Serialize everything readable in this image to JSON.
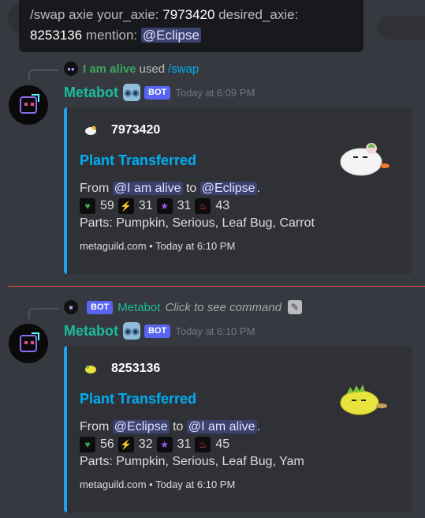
{
  "tooltip": {
    "cmd": "/swap",
    "label_axie": "axie",
    "label_your": "your_axie:",
    "your_val": "7973420",
    "label_desired": "desired_axie:",
    "desired_val": "8253136",
    "label_mention": "mention:",
    "mention_val": "@Eclipse"
  },
  "messages": [
    {
      "reply": {
        "user": "I am alive",
        "used": "used",
        "command": "/swap"
      },
      "author": "Metabot",
      "bot_tag": "BOT",
      "timestamp": "Today at 6:09 PM",
      "embed": {
        "author": "7973420",
        "title": "Plant Transferred",
        "from_label": "From",
        "from_user": "@I am alive",
        "to_label": "to",
        "to_user": "@Eclipse",
        "period": ".",
        "stats": [
          "59",
          "31",
          "31",
          "43"
        ],
        "parts": "Parts: Pumpkin, Serious, Leaf Bug, Carrot",
        "footer_site": "metaguild.com",
        "footer_sep": "•",
        "footer_time": "Today at 6:10 PM"
      }
    },
    {
      "reply": {
        "bot_tag": "BOT",
        "bot_name": "Metabot",
        "click": "Click to see command"
      },
      "author": "Metabot",
      "bot_tag": "BOT",
      "timestamp": "Today at 6:10 PM",
      "embed": {
        "author": "8253136",
        "title": "Plant Transferred",
        "from_label": "From",
        "from_user": "@Eclipse",
        "to_label": "to",
        "to_user": "@I am alive",
        "period": ".",
        "stats": [
          "56",
          "32",
          "31",
          "45"
        ],
        "parts": "Parts: Pumpkin, Serious, Leaf Bug, Yam",
        "footer_site": "metaguild.com",
        "footer_sep": "•",
        "footer_time": "Today at 6:10 PM"
      }
    }
  ],
  "colors": {
    "accent": "#1da1f2",
    "bot_name": "#1abc9c",
    "mention_bg": "#3c4270",
    "divider": "#f04747"
  }
}
